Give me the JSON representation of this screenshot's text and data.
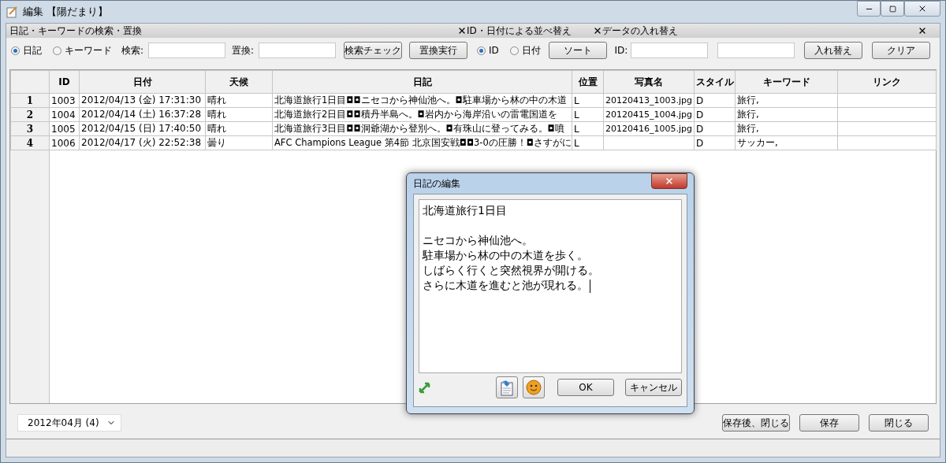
{
  "window": {
    "title": "編集 【陽だまり】"
  },
  "panels": [
    {
      "title": "日記・キーワードの検索・置換"
    },
    {
      "title": "ID・日付による並べ替え"
    },
    {
      "title": "データの入れ替え"
    }
  ],
  "search": {
    "modes": [
      {
        "label": "日記",
        "selected": true
      },
      {
        "label": "キーワード",
        "selected": false
      }
    ],
    "search_label": "検索:",
    "replace_label": "置換:",
    "buttons": [
      "検索チェック",
      "置換実行"
    ]
  },
  "sort": {
    "modes": [
      {
        "label": "ID",
        "selected": true
      },
      {
        "label": "日付",
        "selected": false
      }
    ],
    "button": "ソート"
  },
  "swap": {
    "id_label": "ID:",
    "buttons": [
      "入れ替え",
      "クリア"
    ]
  },
  "table": {
    "columns": [
      "ID",
      "日付",
      "天候",
      "日記",
      "位置",
      "写真名",
      "スタイル",
      "キーワード",
      "リンク"
    ],
    "rows": [
      {
        "number": "1",
        "cells": [
          "1003",
          "2012/04/13 (金) 17:31:30",
          "晴れ",
          "北海道旅行1日目◘◘ニセコから神仙池へ。◘駐車場から林の中の木道",
          "L",
          "20120413_1003.jpg",
          "D",
          "旅行,",
          ""
        ]
      },
      {
        "number": "2",
        "cells": [
          "1004",
          "2012/04/14 (土) 16:37:28",
          "晴れ",
          "北海道旅行2日目◘◘積丹半島へ。◘岩内から海岸沿いの雷電国道を",
          "L",
          "20120415_1004.jpg",
          "D",
          "旅行,",
          ""
        ]
      },
      {
        "number": "3",
        "cells": [
          "1005",
          "2012/04/15 (日) 17:40:50",
          "晴れ",
          "北海道旅行3日目◘◘洞爺湖から登別へ。◘有珠山に登ってみる。◘噴",
          "L",
          "20120416_1005.jpg",
          "D",
          "旅行,",
          ""
        ]
      },
      {
        "number": "4",
        "cells": [
          "1006",
          "2012/04/17 (火) 22:52:38",
          "曇り",
          "AFC Champions League 第4節 北京国安戦◘◘3-0の圧勝！◘さすがに",
          "L",
          "",
          "D",
          "サッカー,",
          ""
        ]
      }
    ]
  },
  "month_select": {
    "value": "2012年04月 (4)"
  },
  "bottom_buttons": [
    "保存後、閉じる",
    "保存",
    "閉じる"
  ],
  "dialog": {
    "title": "日記の編集",
    "paragraphs": [
      [
        "北海道旅行1日目"
      ],
      [
        "ニセコから神仙池へ。",
        "駐車場から林の中の木道を歩く。",
        "しばらく行くと突然視界が開ける。",
        "さらに木道を進むと池が現れる。"
      ]
    ],
    "buttons": [
      "OK",
      "キャンセル"
    ]
  }
}
